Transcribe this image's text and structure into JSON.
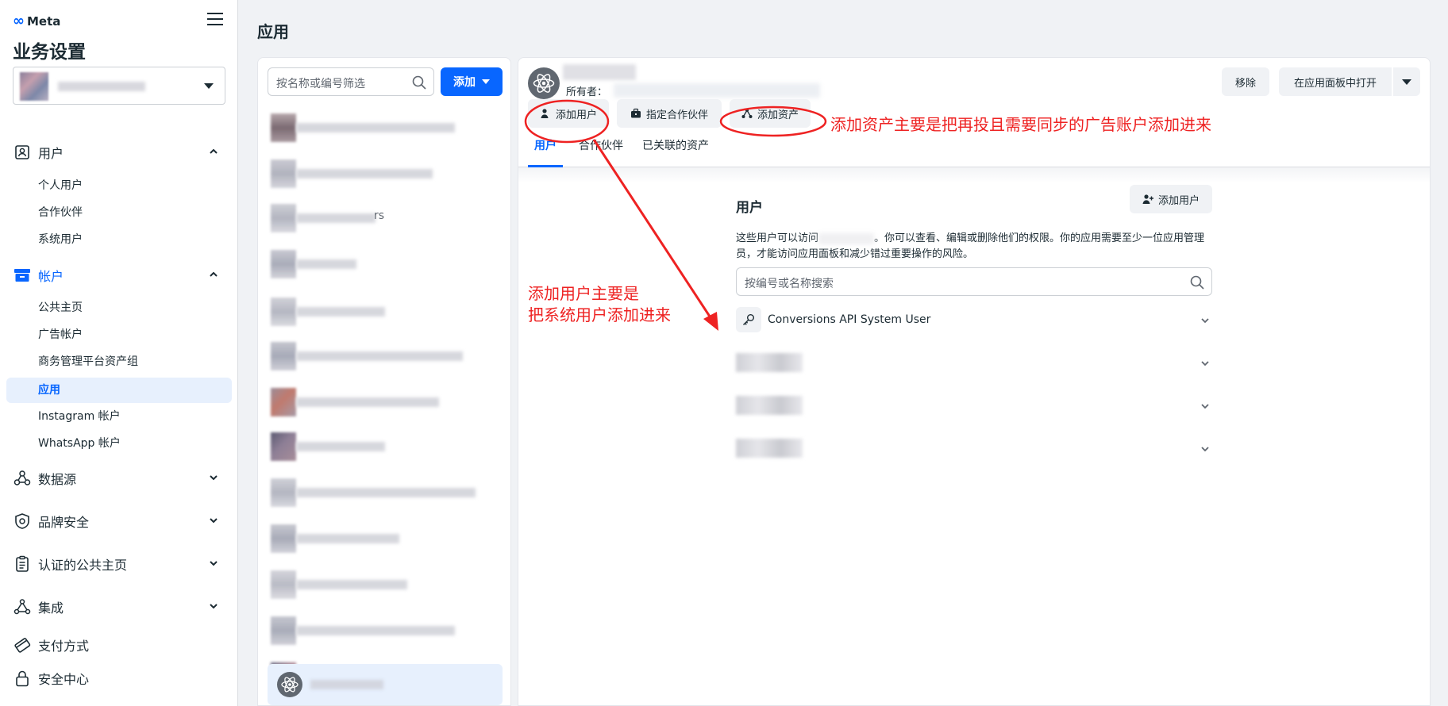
{
  "nav": {
    "logo": "Meta",
    "title": "业务设置",
    "sections": {
      "users": "用户",
      "accounts": "帐户",
      "data_sources": "数据源",
      "brand_safety": "品牌安全",
      "verified_pages": "认证的公共主页",
      "integrations": "集成",
      "payments": "支付方式",
      "security": "安全中心"
    },
    "users_items": [
      "个人用户",
      "合作伙伴",
      "系统用户"
    ],
    "accounts_items": [
      "公共主页",
      "广告帐户",
      "商务管理平台资产组",
      "应用",
      "Instagram 帐户",
      "WhatsApp 帐户"
    ]
  },
  "page": {
    "title": "应用"
  },
  "list": {
    "search_placeholder": "按名称或编号筛选",
    "add_label": "添加",
    "row_tail": "rs"
  },
  "detail": {
    "owner_label": "所有者：",
    "remove_label": "移除",
    "open_label": "在应用面板中打开",
    "actions": {
      "add_people": "添加用户",
      "assign_partner": "指定合作伙伴",
      "add_assets": "添加资产"
    },
    "tabs": [
      "用户",
      "合作伙伴",
      "已关联的资产"
    ],
    "users": {
      "heading": "用户",
      "add_label": "添加用户",
      "desc_before": "这些用户可以访问",
      "desc_after": "。你可以查看、编辑或删除他们的权限。你的应用需要至少一位应用管理员，才能访问应用面板和减少错过重要操作的风险。",
      "search_placeholder": "按编号或名称搜索",
      "system_user": "Conversions API System User"
    }
  },
  "annotations": {
    "assets_note": "添加资产主要是把再投且需要同步的广告账户添加进来",
    "users_note_line1": "添加用户主要是",
    "users_note_line2": "把系统用户添加进来",
    "color": "#ee2222"
  },
  "colors": {
    "accent": "#0866ff",
    "active_bg": "#e7f0fd",
    "page_bg": "#f0f2f5"
  }
}
